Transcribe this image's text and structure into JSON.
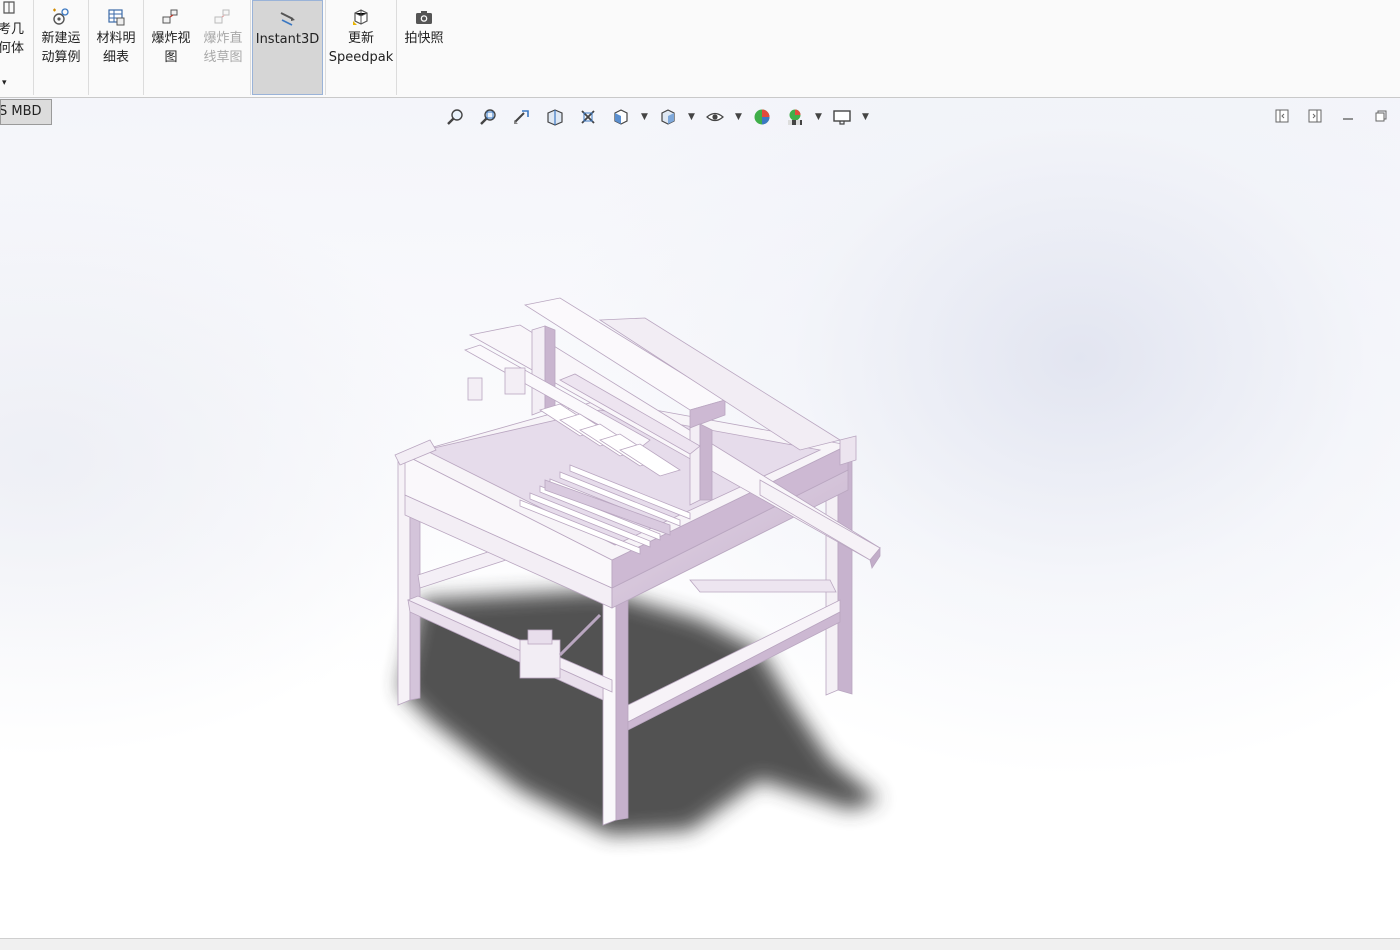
{
  "ribbon": {
    "items": [
      {
        "label": "考几\n何体",
        "state": "normal"
      },
      {
        "label": "新建运\n动算例",
        "state": "normal"
      },
      {
        "label": "材料明\n细表",
        "state": "normal"
      },
      {
        "label": "爆炸视\n图",
        "state": "normal"
      },
      {
        "label": "爆炸直\n线草图",
        "state": "disabled"
      },
      {
        "label": "Instant3D",
        "state": "active"
      },
      {
        "label": "更新\nSpeedpak",
        "state": "normal"
      },
      {
        "label": "拍快照",
        "state": "normal"
      }
    ],
    "dropdown_arrow": "▾"
  },
  "tabs": {
    "mbd": "S MBD"
  },
  "heads_up_toolbar": {
    "icons": [
      "zoom-to-fit-icon",
      "zoom-to-area-icon",
      "previous-view-icon",
      "section-view-icon",
      "dynamic-annotation-icon",
      "view-orientation-icon",
      "display-style-icon",
      "hide-show-items-icon",
      "edit-appearance-icon",
      "apply-scene-icon",
      "view-settings-icon"
    ]
  },
  "colors": {
    "model_face": "#f7f4f8",
    "model_shade": "#c9b6cf",
    "shadow": "#3a3a3a",
    "accent": "#9ab3d8"
  }
}
